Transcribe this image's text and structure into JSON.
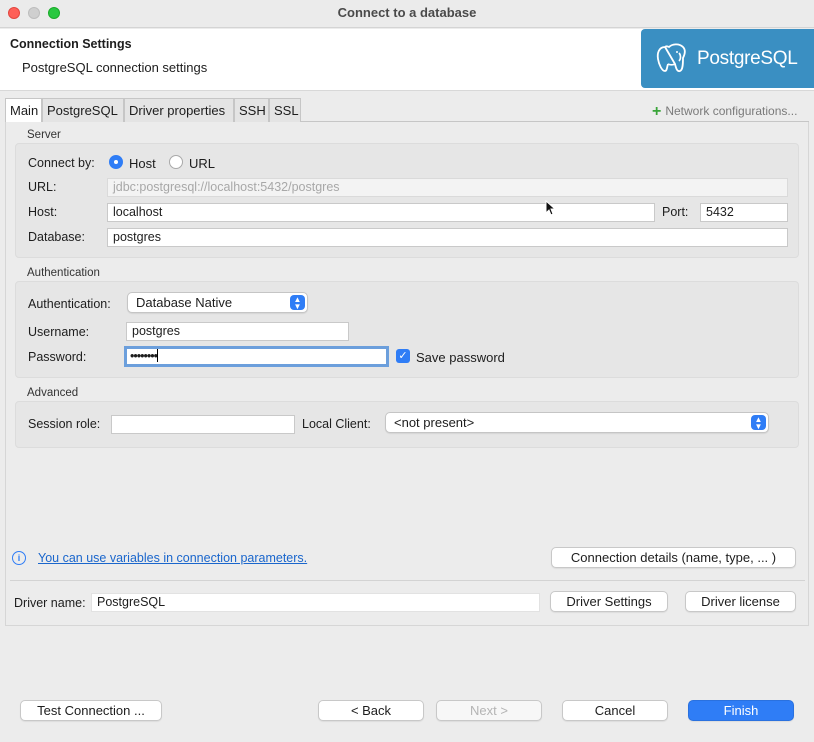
{
  "window": {
    "title": "Connect to a database"
  },
  "header": {
    "title": "Connection Settings",
    "subtitle": "PostgreSQL connection settings",
    "logo_text": "PostgreSQL"
  },
  "tabs": [
    {
      "label": "Main",
      "active": true
    },
    {
      "label": "PostgreSQL"
    },
    {
      "label": "Driver properties"
    },
    {
      "label": "SSH"
    },
    {
      "label": "SSL"
    }
  ],
  "network_config": {
    "label": "Network configurations..."
  },
  "server": {
    "group_label": "Server",
    "connect_by_label": "Connect by:",
    "host_option": "Host",
    "url_option": "URL",
    "selected": "Host",
    "url_label": "URL:",
    "url_value": "jdbc:postgresql://localhost:5432/postgres",
    "host_label": "Host:",
    "host_value": "localhost",
    "port_label": "Port:",
    "port_value": "5432",
    "database_label": "Database:",
    "database_value": "postgres"
  },
  "authentication": {
    "group_label": "Authentication",
    "auth_label": "Authentication:",
    "auth_value": "Database Native",
    "username_label": "Username:",
    "username_value": "postgres",
    "password_label": "Password:",
    "password_value": "••••••••",
    "save_password_label": "Save password",
    "save_password_checked": true
  },
  "advanced": {
    "group_label": "Advanced",
    "session_role_label": "Session role:",
    "session_role_value": "",
    "local_client_label": "Local Client:",
    "local_client_value": "<not present>"
  },
  "info": {
    "variables_link": "You can use variables in connection parameters.",
    "connection_details_button": "Connection details (name, type, ... )"
  },
  "driver": {
    "name_label": "Driver name:",
    "name_value": "PostgreSQL",
    "settings_button": "Driver Settings",
    "license_button": "Driver license"
  },
  "footer": {
    "test_button": "Test Connection ...",
    "back_button": "< Back",
    "next_button": "Next >",
    "cancel_button": "Cancel",
    "finish_button": "Finish"
  },
  "colors": {
    "accent": "#2f7df6",
    "logo_bg": "#3a8fc2",
    "close": "#fe5f57",
    "maximize": "#28c840",
    "plus": "#3aa53a"
  }
}
